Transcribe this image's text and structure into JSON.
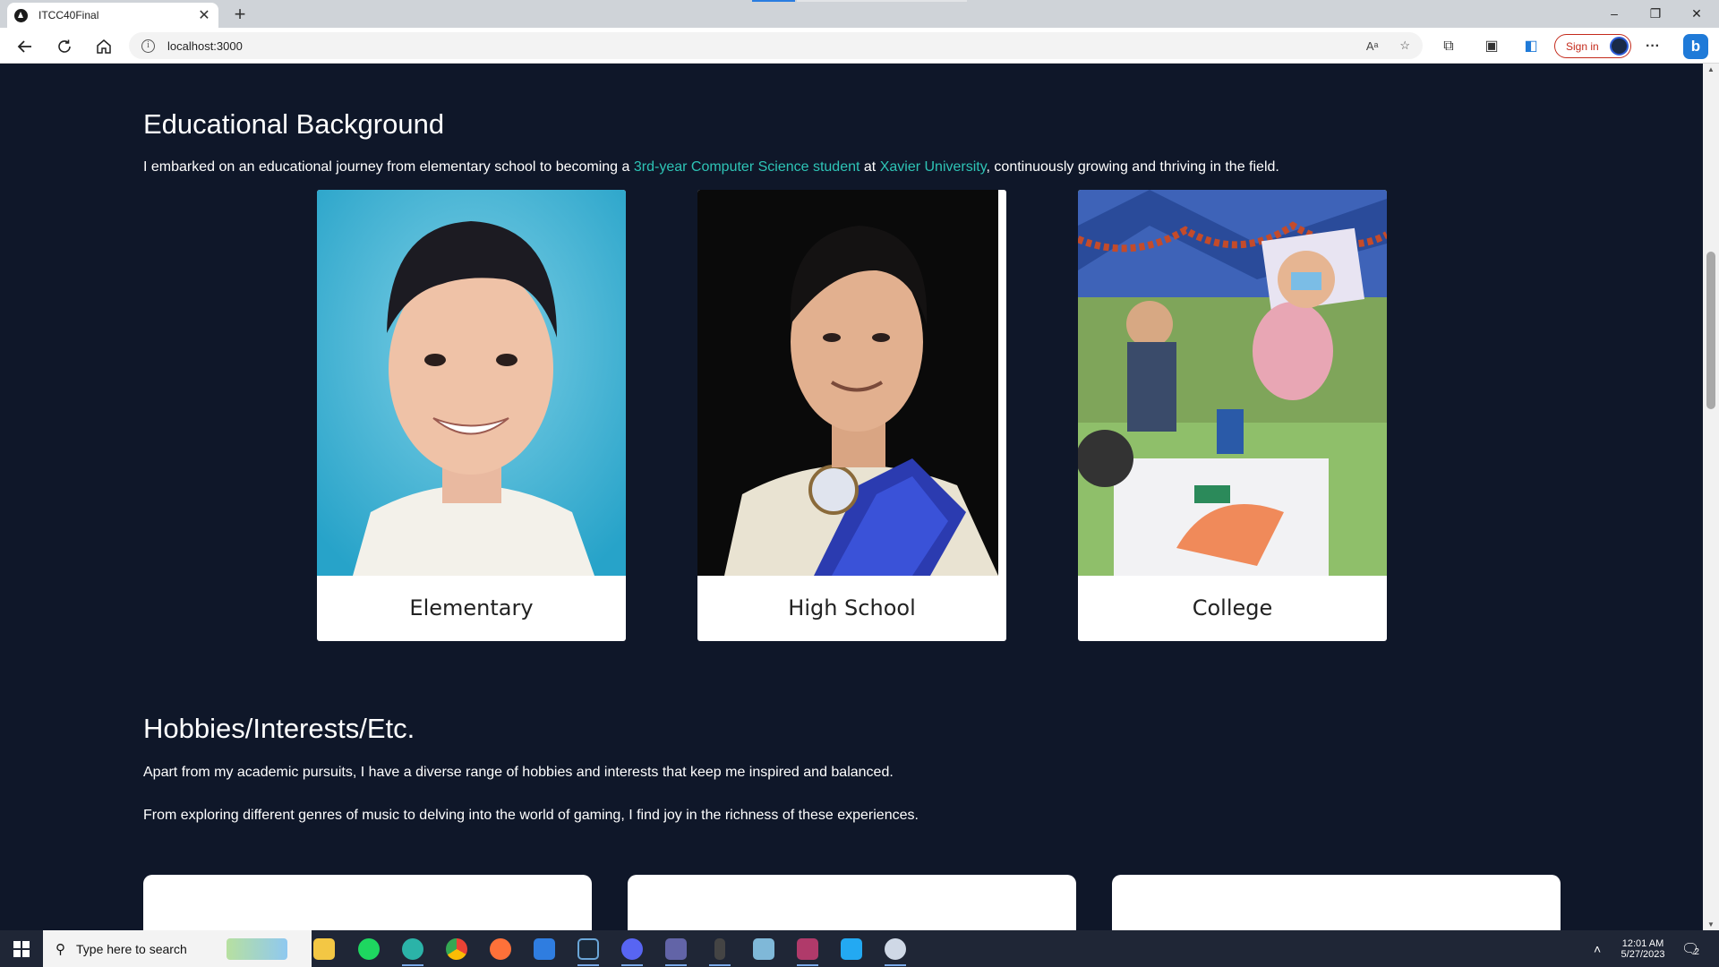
{
  "browser": {
    "tab_title": "ITCC40Final",
    "tab_close": "✕",
    "new_tab": "+",
    "url": "localhost:3000",
    "sign_in": "Sign in",
    "window_controls": [
      "–",
      "❐",
      "✕"
    ],
    "nav_icons": [
      "back-icon",
      "refresh-icon",
      "home-icon"
    ],
    "toolbar_icons": [
      "read-aloud-icon",
      "favorite-icon",
      "extensions-icon",
      "collections-icon",
      "edge-bar-icon",
      "more-icon",
      "bing-icon"
    ]
  },
  "education": {
    "heading": "Educational Background",
    "intro_pre": "I embarked on an educational journey from elementary school to becoming a ",
    "intro_link1": "3rd-year Computer Science student",
    "intro_mid": " at ",
    "intro_link2": "Xavier University",
    "intro_post": ", continuously growing and thriving in the field.",
    "cards": [
      {
        "caption": "Elementary"
      },
      {
        "caption": "High School"
      },
      {
        "caption": "College"
      }
    ]
  },
  "hobbies": {
    "heading": "Hobbies/Interests/Etc.",
    "para1": "Apart from my academic pursuits, I have a diverse range of hobbies and interests that keep me inspired and balanced.",
    "para2": "From exploring different genres of music to delving into the world of gaming, I find joy in the richness of these experiences."
  },
  "taskbar": {
    "search_placeholder": "Type here to search",
    "time": "12:01 AM",
    "date": "5/27/2023",
    "notification_count": "2",
    "apps": [
      "file-explorer",
      "spotify",
      "edge",
      "chrome",
      "firefox",
      "app-installer",
      "steam",
      "discord",
      "teams",
      "terminal",
      "notes",
      "winrar",
      "vscode",
      "paint"
    ]
  },
  "colors": {
    "page_bg": "#0f1729",
    "accent_text": "#2ec4b6",
    "signin_red": "#c42b1c"
  }
}
